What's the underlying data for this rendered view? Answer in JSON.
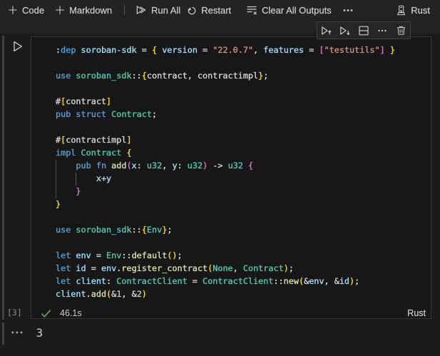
{
  "toolbar": {
    "code_label": "Code",
    "markdown_label": "Markdown",
    "run_all_label": "Run All",
    "restart_label": "Restart",
    "clear_outputs_label": "Clear All Outputs",
    "more_icon": "ellipsis",
    "kernel": {
      "label": "Rust",
      "icon": "server-environment"
    }
  },
  "cell_toolbar": {
    "buttons": [
      "execute-above",
      "execute-below",
      "split-cell",
      "more-actions",
      "delete-cell"
    ]
  },
  "cell": {
    "run_icon": "play-outline",
    "execution_count": "[3]",
    "status": {
      "icon": "check",
      "color": "#5fb15f",
      "duration": "46.1s"
    },
    "language": "Rust",
    "output": {
      "value": "3",
      "menu_icon": "ellipsis"
    }
  },
  "code": {
    "palette": {
      "kw": "#569cd6",
      "var": "#9cdcfe",
      "type": "#4ec9b0",
      "fn": "#dcdcaa",
      "str": "#ce9178",
      "num": "#b5cea8",
      "fg": "#d4d4d4",
      "b1": "#ffd700",
      "b2": "#da70d6"
    },
    "lines": [
      [
        [
          "fg",
          ":"
        ],
        [
          "kw",
          "dep"
        ],
        [
          "fg",
          " "
        ],
        [
          "var",
          "soroban-sdk"
        ],
        [
          "fg",
          " = "
        ],
        [
          "b1",
          "{"
        ],
        [
          "fg",
          " "
        ],
        [
          "var",
          "version"
        ],
        [
          "fg",
          " = "
        ],
        [
          "str",
          "\"22.0.7\""
        ],
        [
          "fg",
          ", "
        ],
        [
          "var",
          "features"
        ],
        [
          "fg",
          " = "
        ],
        [
          "b2",
          "["
        ],
        [
          "str",
          "\"testutils\""
        ],
        [
          "b2",
          "]"
        ],
        [
          "fg",
          " "
        ],
        [
          "b1",
          "}"
        ]
      ],
      [],
      [
        [
          "kw",
          "use"
        ],
        [
          "fg",
          " "
        ],
        [
          "type",
          "soroban_sdk"
        ],
        [
          "fg",
          "::"
        ],
        [
          "b1",
          "{"
        ],
        [
          "fg",
          "contract, contractimpl"
        ],
        [
          "b1",
          "}"
        ],
        [
          "fg",
          ";"
        ]
      ],
      [],
      [
        [
          "fg",
          "#"
        ],
        [
          "b1",
          "["
        ],
        [
          "fg",
          "contract"
        ],
        [
          "b1",
          "]"
        ]
      ],
      [
        [
          "kw",
          "pub"
        ],
        [
          "fg",
          " "
        ],
        [
          "kw",
          "struct"
        ],
        [
          "fg",
          " "
        ],
        [
          "type",
          "Contract"
        ],
        [
          "fg",
          ";"
        ]
      ],
      [],
      [
        [
          "fg",
          "#"
        ],
        [
          "b1",
          "["
        ],
        [
          "fg",
          "contractimpl"
        ],
        [
          "b1",
          "]"
        ]
      ],
      [
        [
          "kw",
          "impl"
        ],
        [
          "fg",
          " "
        ],
        [
          "type",
          "Contract"
        ],
        [
          "fg",
          " "
        ],
        [
          "b1",
          "{"
        ]
      ],
      [
        [
          "fg",
          "    "
        ],
        [
          "kw",
          "pub"
        ],
        [
          "fg",
          " "
        ],
        [
          "kw",
          "fn"
        ],
        [
          "fg",
          " "
        ],
        [
          "fn",
          "add"
        ],
        [
          "b2",
          "("
        ],
        [
          "var",
          "x"
        ],
        [
          "fg",
          ": "
        ],
        [
          "type",
          "u32"
        ],
        [
          "fg",
          ", "
        ],
        [
          "var",
          "y"
        ],
        [
          "fg",
          ": "
        ],
        [
          "type",
          "u32"
        ],
        [
          "b2",
          ")"
        ],
        [
          "fg",
          " -> "
        ],
        [
          "type",
          "u32"
        ],
        [
          "fg",
          " "
        ],
        [
          "b2",
          "{"
        ]
      ],
      [
        [
          "fg",
          "        "
        ],
        [
          "var",
          "x"
        ],
        [
          "fg",
          "+"
        ],
        [
          "var",
          "y"
        ]
      ],
      [
        [
          "fg",
          "    "
        ],
        [
          "b2",
          "}"
        ]
      ],
      [
        [
          "b1",
          "}"
        ]
      ],
      [],
      [
        [
          "kw",
          "use"
        ],
        [
          "fg",
          " "
        ],
        [
          "type",
          "soroban_sdk"
        ],
        [
          "fg",
          "::"
        ],
        [
          "b1",
          "{"
        ],
        [
          "type",
          "Env"
        ],
        [
          "b1",
          "}"
        ],
        [
          "fg",
          ";"
        ]
      ],
      [],
      [
        [
          "kw",
          "let"
        ],
        [
          "fg",
          " "
        ],
        [
          "var",
          "env"
        ],
        [
          "fg",
          " = "
        ],
        [
          "type",
          "Env"
        ],
        [
          "fg",
          "::"
        ],
        [
          "fn",
          "default"
        ],
        [
          "b1",
          "()"
        ],
        [
          "fg",
          ";"
        ]
      ],
      [
        [
          "kw",
          "let"
        ],
        [
          "fg",
          " "
        ],
        [
          "var",
          "id"
        ],
        [
          "fg",
          " = "
        ],
        [
          "var",
          "env"
        ],
        [
          "fg",
          "."
        ],
        [
          "fn",
          "register_contract"
        ],
        [
          "b1",
          "("
        ],
        [
          "type",
          "None"
        ],
        [
          "fg",
          ", "
        ],
        [
          "type",
          "Contract"
        ],
        [
          "b1",
          ")"
        ],
        [
          "fg",
          ";"
        ]
      ],
      [
        [
          "kw",
          "let"
        ],
        [
          "fg",
          " "
        ],
        [
          "var",
          "client"
        ],
        [
          "fg",
          ": "
        ],
        [
          "type",
          "ContractClient"
        ],
        [
          "fg",
          " = "
        ],
        [
          "type",
          "ContractClient"
        ],
        [
          "fg",
          "::"
        ],
        [
          "fn",
          "new"
        ],
        [
          "b1",
          "("
        ],
        [
          "fg",
          "&"
        ],
        [
          "var",
          "env"
        ],
        [
          "fg",
          ", &"
        ],
        [
          "var",
          "id"
        ],
        [
          "b1",
          ")"
        ],
        [
          "fg",
          ";"
        ]
      ],
      [
        [
          "var",
          "client"
        ],
        [
          "fg",
          "."
        ],
        [
          "fn",
          "add"
        ],
        [
          "b1",
          "("
        ],
        [
          "fg",
          "&"
        ],
        [
          "num",
          "1"
        ],
        [
          "fg",
          ", &"
        ],
        [
          "num",
          "2"
        ],
        [
          "b1",
          ")"
        ]
      ]
    ]
  }
}
